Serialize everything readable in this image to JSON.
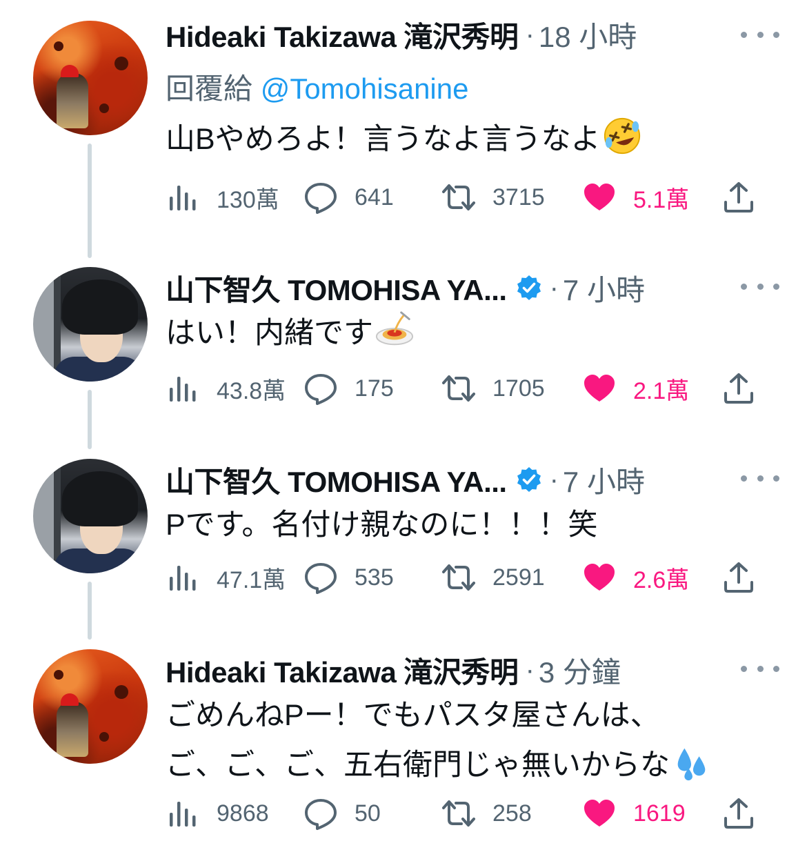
{
  "tweets": [
    {
      "author": "Hideaki Takizawa 滝沢秀明",
      "verified": false,
      "time": "18 小時",
      "reply_prefix": "回覆給",
      "reply_mention": "@Tomohisanine",
      "text": "山Bやめろよ！言うなよ言うなよ",
      "emoji": "rolling-on-floor-laughing",
      "views": "130萬",
      "replies": "641",
      "retweets": "3715",
      "likes": "5.1萬"
    },
    {
      "author": "山下智久 TOMOHISA YA...",
      "verified": true,
      "time": "7 小時",
      "text": "はい！内緒です",
      "emoji": "spaghetti",
      "views": "43.8萬",
      "replies": "175",
      "retweets": "1705",
      "likes": "2.1萬"
    },
    {
      "author": "山下智久 TOMOHISA YA...",
      "verified": true,
      "time": "7 小時",
      "text": "Pです。名付け親なのに！！！笑",
      "views": "47.1萬",
      "replies": "535",
      "retweets": "2591",
      "likes": "2.6萬"
    },
    {
      "author": "Hideaki Takizawa 滝沢秀明",
      "verified": false,
      "time": "3 分鐘",
      "text_line1": "ごめんねPー！でもパスタ屋さんは、",
      "text_line2": "ご、ご、ご、五右衛門じゃ無いからな",
      "emoji": "sweat-droplets",
      "views": "9868",
      "replies": "50",
      "retweets": "258",
      "likes": "1619"
    }
  ],
  "separator_dot": "·",
  "colors": {
    "text": "#0f1419",
    "secondary": "#536471",
    "link": "#1d9bf0",
    "like": "#f91880",
    "thread_line": "#cfd9de"
  }
}
